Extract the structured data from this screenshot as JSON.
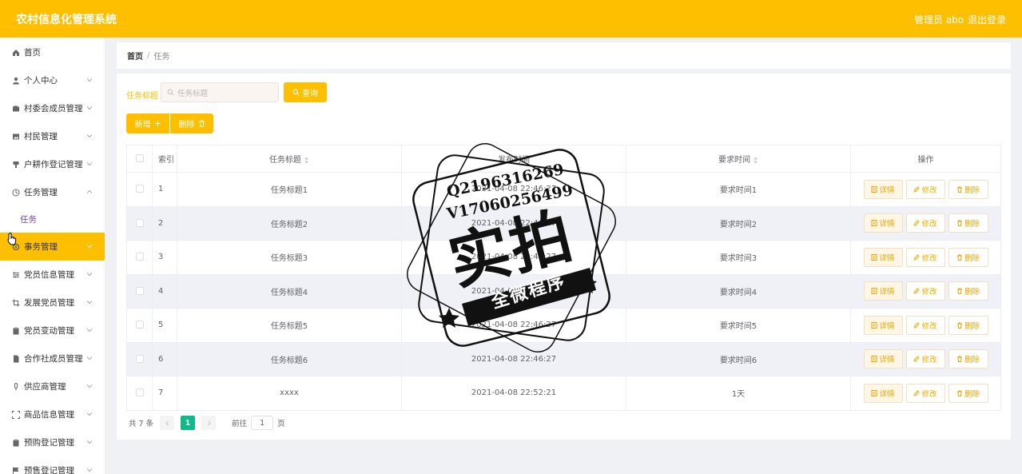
{
  "app": {
    "title": "农村信息化管理系统",
    "user": "管理员 abo",
    "logout": "退出登录"
  },
  "sidebar": {
    "items": [
      {
        "label": "首页",
        "icon": "home-icon",
        "expand": false
      },
      {
        "label": "个人中心",
        "icon": "person-icon",
        "expand": true
      },
      {
        "label": "村委会成员管理",
        "icon": "wallet-icon",
        "expand": true
      },
      {
        "label": "村民管理",
        "icon": "picture-icon",
        "expand": true
      },
      {
        "label": "户耕作登记管理",
        "icon": "stamp-icon",
        "expand": true
      },
      {
        "label": "任务管理",
        "icon": "clock-icon",
        "expand": true,
        "open": true
      },
      {
        "label": "事务管理",
        "icon": "gear-icon",
        "expand": true,
        "active": true
      },
      {
        "label": "党员信息管理",
        "icon": "sliders-icon",
        "expand": true
      },
      {
        "label": "发展党员管理",
        "icon": "crop-icon",
        "expand": true
      },
      {
        "label": "党员变动管理",
        "icon": "clipboard-icon",
        "expand": true
      },
      {
        "label": "合作社成员管理",
        "icon": "document-icon",
        "expand": true
      },
      {
        "label": "供应商管理",
        "icon": "microphone-icon",
        "expand": true
      },
      {
        "label": "商品信息管理",
        "icon": "fullscreen-icon",
        "expand": true
      },
      {
        "label": "预购登记管理",
        "icon": "clipboard-icon",
        "expand": true
      },
      {
        "label": "预售登记管理",
        "icon": "flag-icon",
        "expand": true
      }
    ],
    "submenu": {
      "label": "任务"
    }
  },
  "breadcrumb": {
    "home": "首页",
    "sep": "/",
    "current": "任务"
  },
  "search": {
    "label": "任务标题",
    "placeholder": "任务标题",
    "button": "查询"
  },
  "actions": {
    "add": "新增",
    "delete": "删除"
  },
  "table": {
    "headers": {
      "index": "索引",
      "title": "任务标题",
      "time": "发布时间",
      "required": "要求时间",
      "ops": "操作"
    },
    "rows": [
      {
        "idx": "1",
        "title": "任务标题1",
        "time": "2021-04-08 22:46:27",
        "req": "要求时间1"
      },
      {
        "idx": "2",
        "title": "任务标题2",
        "time": "2021-04-08 22:46:27",
        "req": "要求时间2"
      },
      {
        "idx": "3",
        "title": "任务标题3",
        "time": "2021-04-08 22:46:27",
        "req": "要求时间3"
      },
      {
        "idx": "4",
        "title": "任务标题4",
        "time": "2021-04-08 22:46:27",
        "req": "要求时间4"
      },
      {
        "idx": "5",
        "title": "任务标题5",
        "time": "2021-04-08 22:46:27",
        "req": "要求时间5"
      },
      {
        "idx": "6",
        "title": "任务标题6",
        "time": "2021-04-08 22:46:27",
        "req": "要求时间6"
      },
      {
        "idx": "7",
        "title": "xxxx",
        "time": "2021-04-08 22:52:21",
        "req": "1天"
      }
    ],
    "ops": {
      "detail": "详情",
      "edit": "修改",
      "delete": "删除"
    }
  },
  "pagination": {
    "total": "共 7 条",
    "current": "1",
    "goto_label": "前往",
    "goto_value": "1",
    "page_unit": "页"
  },
  "watermark": {
    "line1": "Q2196316269",
    "line2": "V17060256499",
    "big": "实拍",
    "band": "全微程序"
  }
}
